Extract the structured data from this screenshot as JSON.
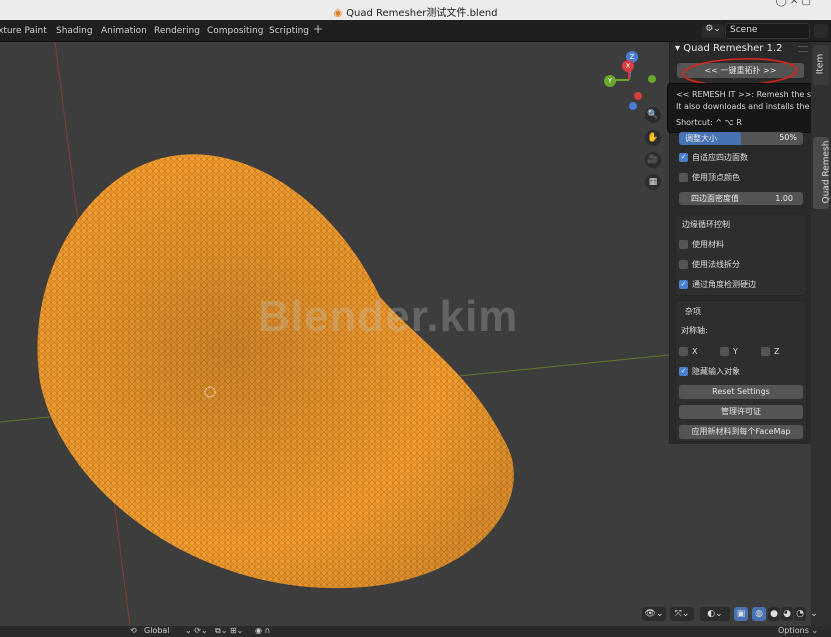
{
  "window": {
    "title": "Quad Remesher测试文件.blend"
  },
  "workspace_tabs": [
    "xture Paint",
    "Shading",
    "Animation",
    "Rendering",
    "Compositing",
    "Scripting"
  ],
  "tab_plus": "+",
  "scene": {
    "icon": "scene-icon",
    "name": "Scene"
  },
  "watermark": "Blender.kim",
  "side_tabs": {
    "item": "Item",
    "quad_remesh": "Quad Remesh"
  },
  "panel": {
    "header": "▾ Quad Remesher 1.2",
    "remesh_button": "<<  一键重拓扑  >>",
    "tooltip": {
      "line1": "<<  REMESH IT  >>: Remesh the selecte",
      "line2": "It also downloads and installs the Remes",
      "line3": "Shortcut: ^ ⌥ R"
    },
    "adapt_size": {
      "label": "调整大小",
      "value": "50%",
      "fraction": 0.5
    },
    "adaptive_quad_count": {
      "label": "自适应四边面数",
      "checked": true
    },
    "use_vertex_color": {
      "label": "使用顶点颜色",
      "checked": false
    },
    "quad_density": {
      "label": "四边面密度值",
      "value": "1.00"
    },
    "edge_loops_title": "边缘循环控制",
    "use_materials": {
      "label": "使用材料",
      "checked": false
    },
    "use_normals_split": {
      "label": "使用法线拆分",
      "checked": false
    },
    "detect_hard_edges": {
      "label": "通过角度检测硬边",
      "checked": true
    },
    "misc_title": "杂项",
    "symmetry_label": "对称轴:",
    "sym_x": {
      "label": "X",
      "checked": false
    },
    "sym_y": {
      "label": "Y",
      "checked": false
    },
    "sym_z": {
      "label": "Z",
      "checked": false
    },
    "hide_input": {
      "label": "隐藏输入对象",
      "checked": true
    },
    "reset_settings": "Reset Settings",
    "manage_license": "管理许可证",
    "apply_material": "应用新材料到每个FaceMap"
  },
  "gizmo": {
    "z": "Z",
    "x": "X",
    "y": "Y"
  },
  "bottom": {
    "transform": "Global",
    "options": "Options ⌄"
  },
  "colors": {
    "mesh": "#f29a2e",
    "accent": "#4772b3",
    "annotation": "#d9261c"
  }
}
